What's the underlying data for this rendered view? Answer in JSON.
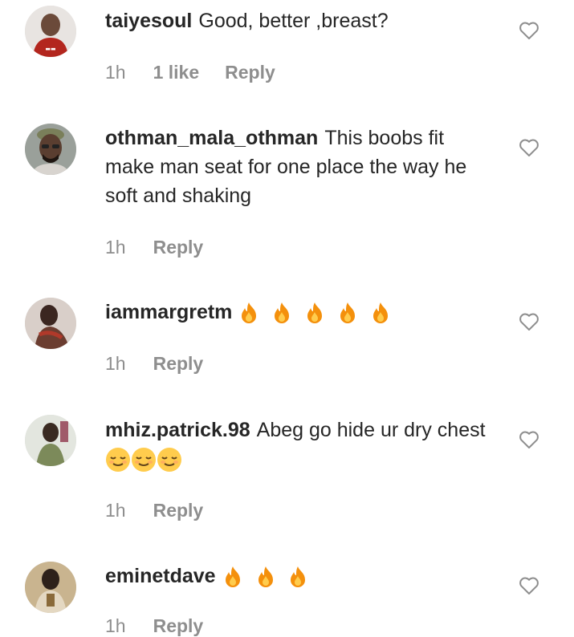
{
  "comments": [
    {
      "username": "taiyesoul",
      "text": "Good, better ,breast?",
      "time": "1h",
      "likes": "1 like",
      "reply": "Reply",
      "avatar_color": "#b3261e"
    },
    {
      "username": "othman_mala_othman",
      "text": "This boobs fit make man seat for one place the way he soft and shaking",
      "time": "1h",
      "reply": "Reply",
      "avatar_color": "#5a4a3f"
    },
    {
      "username": "iammargretm",
      "text": "",
      "emoji": [
        "fire",
        "fire",
        "fire",
        "fire",
        "fire"
      ],
      "time": "1h",
      "reply": "Reply",
      "avatar_color": "#6b4b40"
    },
    {
      "username": "mhiz.patrick.98",
      "text": "Abeg go hide ur dry chest",
      "emoji": [
        "relieved-face",
        "relieved-face",
        "relieved-face"
      ],
      "time": "1h",
      "reply": "Reply",
      "avatar_color": "#7c8a5a"
    },
    {
      "username": "eminetdave",
      "text": "",
      "emoji": [
        "fire",
        "fire",
        "fire"
      ],
      "time": "1h",
      "reply": "Reply",
      "avatar_color": "#8a6a3a"
    }
  ],
  "colors": {
    "text": "#262626",
    "meta": "#8e8e8e",
    "heart": "#8e8e8e",
    "fire_outer": "#f4900c",
    "fire_inner": "#ffcc4d",
    "emoji_face": "#ffcc4d"
  }
}
